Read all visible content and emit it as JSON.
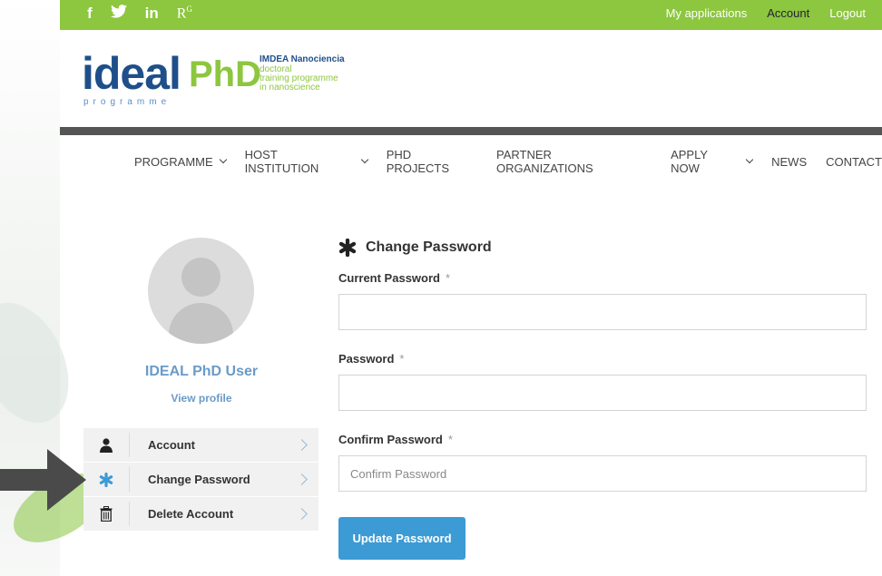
{
  "topbar": {
    "social": {
      "facebook": "f",
      "twitter": "twitter-bird",
      "linkedin": "in",
      "researchgate": "R",
      "researchgate_sup": "G"
    },
    "links": {
      "my_applications": "My applications",
      "account": "Account",
      "logout": "Logout"
    },
    "color": "#8dc63f"
  },
  "logo": {
    "ideal": "ideal",
    "phd": "PhD",
    "programme": "programme",
    "imdea": "IMDEA Nanociencia",
    "line1": "doctoral",
    "line2": "training programme",
    "line3": "in nanoscience"
  },
  "nav": {
    "programme": "PROGRAMME",
    "host": "HOST INSTITUTION",
    "projects": "PHD PROJECTS",
    "partners": "PARTNER ORGANIZATIONS",
    "apply": "APPLY NOW",
    "news": "NEWS",
    "contact": "CONTACT"
  },
  "profile": {
    "name": "IDEAL PhD User",
    "view_profile": "View profile"
  },
  "sidebar": {
    "items": [
      {
        "label": "Account",
        "icon": "user-icon"
      },
      {
        "label": "Change Password",
        "icon": "asterisk-icon"
      },
      {
        "label": "Delete Account",
        "icon": "trash-icon"
      }
    ]
  },
  "form": {
    "title": "Change Password",
    "current_label": "Current Password",
    "password_label": "Password",
    "confirm_label": "Confirm Password",
    "required_mark": "*",
    "current_value": "",
    "password_value": "",
    "confirm_placeholder": "Confirm Password",
    "submit": "Update Password"
  },
  "colors": {
    "accent_blue": "#3c9ad4",
    "green": "#8dc63f",
    "dark_blue": "#1e4f8a"
  }
}
